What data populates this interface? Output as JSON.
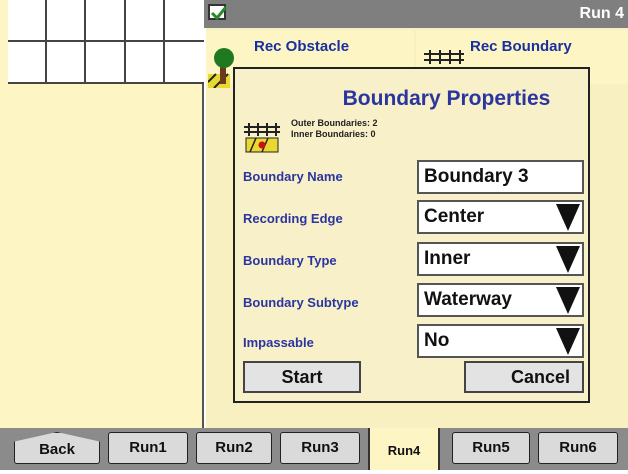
{
  "header": {
    "run_label": "Run 4"
  },
  "toolbar": {
    "rec_obstacle_label": "Rec Obstacle",
    "rec_boundary_label": "Rec Boundary"
  },
  "dialog": {
    "title": "Boundary Properties",
    "outer_boundaries": "Outer Boundaries: 2",
    "inner_boundaries": "Inner Boundaries: 0",
    "fields": [
      {
        "label": "Boundary Name",
        "value": "Boundary 3"
      },
      {
        "label": "Recording Edge",
        "value": "Center"
      },
      {
        "label": "Boundary Type",
        "value": "Inner"
      },
      {
        "label": "Boundary Subtype",
        "value": "Waterway"
      },
      {
        "label": "Impassable",
        "value": "No"
      }
    ],
    "start_label": "Start",
    "cancel_label": "Cancel"
  },
  "tabs": [
    {
      "label": "Back"
    },
    {
      "label": "Run1"
    },
    {
      "label": "Run2"
    },
    {
      "label": "Run3"
    },
    {
      "label": "Run4"
    },
    {
      "label": "Run5"
    },
    {
      "label": "Run6"
    }
  ],
  "colors": {
    "panel": "#fdf6c4",
    "accent_text": "#2b35a0",
    "bar": "#7f7f7f"
  }
}
